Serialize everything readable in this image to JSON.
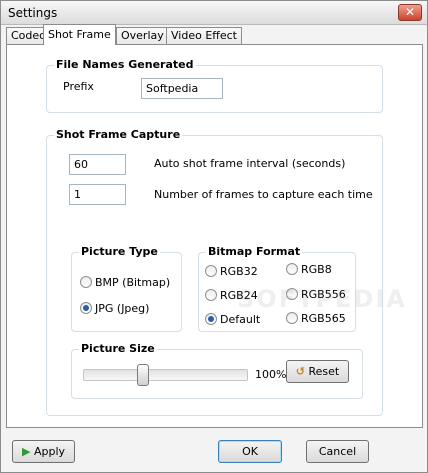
{
  "window": {
    "title": "Settings"
  },
  "tabs": [
    {
      "label": "Codec"
    },
    {
      "label": "Shot Frame"
    },
    {
      "label": "Overlay"
    },
    {
      "label": "Video Effect"
    }
  ],
  "file_names": {
    "title": "File Names Generated",
    "prefix_label": "Prefix",
    "prefix_value": "Softpedia"
  },
  "capture": {
    "title": "Shot Frame Capture",
    "interval_value": "60",
    "interval_label": "Auto shot frame interval (seconds)",
    "frames_value": "1",
    "frames_label": "Number of frames to capture each time"
  },
  "picture_type": {
    "title": "Picture Type",
    "options": [
      {
        "label": "BMP (Bitmap)",
        "checked": false
      },
      {
        "label": "JPG (Jpeg)",
        "checked": true
      }
    ]
  },
  "bitmap_format": {
    "title": "Bitmap Format",
    "options": [
      {
        "label": "RGB32",
        "checked": false
      },
      {
        "label": "RGB24",
        "checked": false
      },
      {
        "label": "Default",
        "checked": true
      },
      {
        "label": "RGB8",
        "checked": false
      },
      {
        "label": "RGB556",
        "checked": false
      },
      {
        "label": "RGB565",
        "checked": false
      }
    ]
  },
  "picture_size": {
    "title": "Picture Size",
    "value_fraction": 0.35,
    "percent_label": "100%",
    "reset_label": "Reset"
  },
  "footer": {
    "apply_label": "Apply",
    "ok_label": "OK",
    "cancel_label": "Cancel"
  },
  "watermark": "SOFTPEDIA"
}
